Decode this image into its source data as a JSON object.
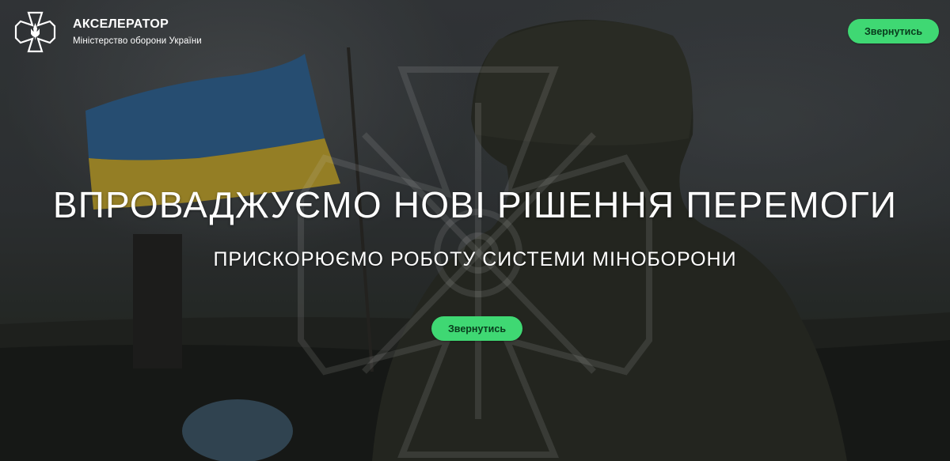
{
  "header": {
    "brand_title": "АКСЕЛЕРАТОР",
    "brand_subtitle": "Міністерство оборони України",
    "contact_button": "Звернутись"
  },
  "hero": {
    "headline": "ВПРОВАДЖУЄМО НОВІ РІШЕННЯ ПЕРЕМОГИ",
    "subheadline": "ПРИСКОРЮЄМО РОБОТУ СИСТЕМИ МІНОБОРОНИ",
    "cta_button": "Звернутись"
  },
  "colors": {
    "accent_green": "#3fd873",
    "flag_blue": "#2f5f8a",
    "flag_yellow": "#b59a2e",
    "text": "#ffffff"
  },
  "icons": {
    "logo": "ministry-of-defense-cross-emblem",
    "watermark": "cross-emblem-watermark"
  }
}
